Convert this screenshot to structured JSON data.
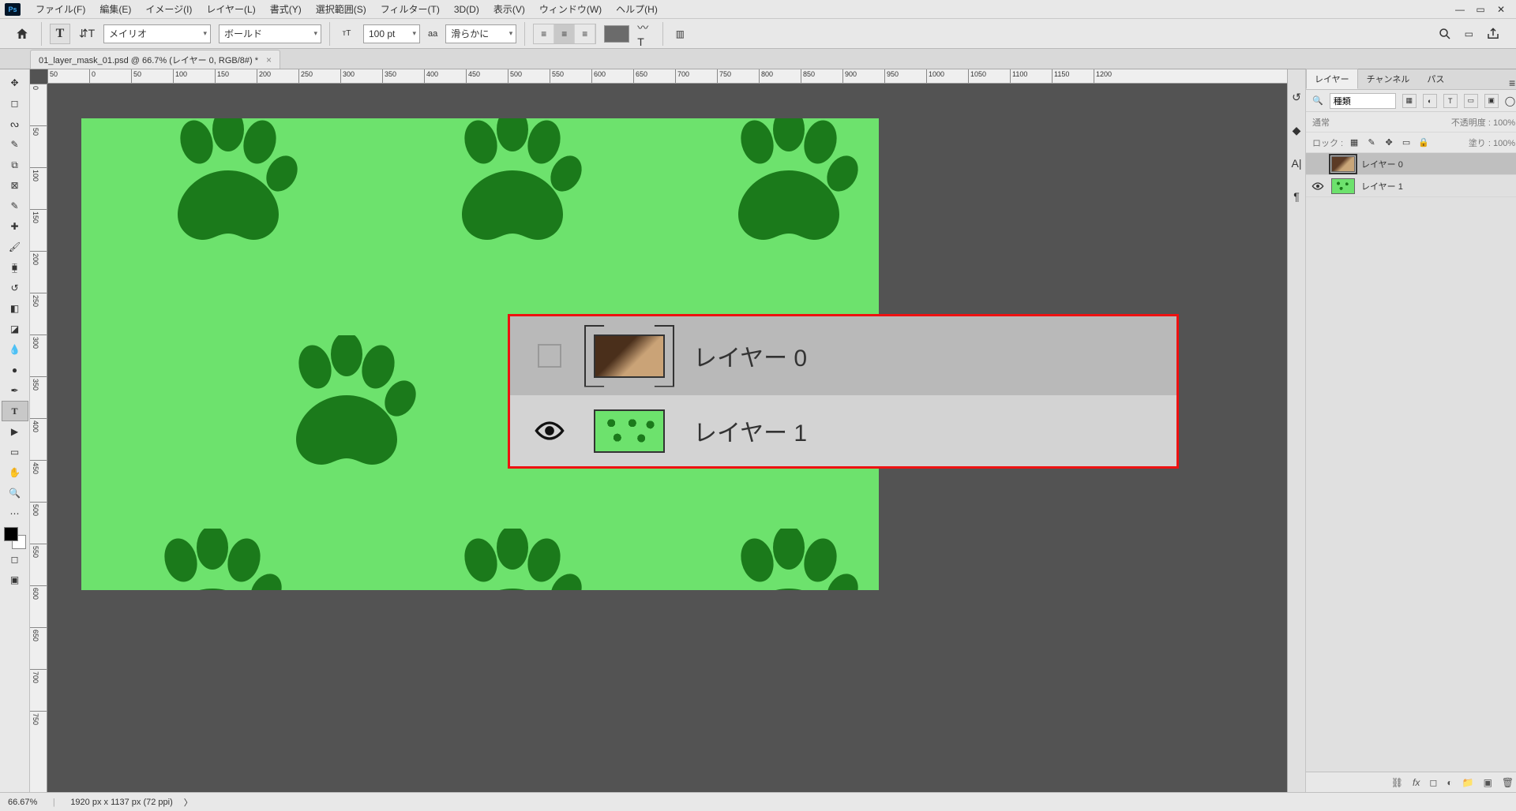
{
  "menu": {
    "items": [
      "ファイル(F)",
      "編集(E)",
      "イメージ(I)",
      "レイヤー(L)",
      "書式(Y)",
      "選択範囲(S)",
      "フィルター(T)",
      "3D(D)",
      "表示(V)",
      "ウィンドウ(W)",
      "ヘルプ(H)"
    ]
  },
  "options": {
    "font_family": "メイリオ",
    "font_weight": "ボールド",
    "font_size": "100 pt",
    "aa_label": "aa",
    "aa_value": "滑らかに"
  },
  "doc": {
    "tab_title": "01_layer_mask_01.psd @ 66.7% (レイヤー 0, RGB/8#) *"
  },
  "ruler_h": [
    50,
    0,
    50,
    100,
    150,
    200,
    250,
    300,
    350,
    400,
    450,
    500,
    550,
    600,
    650,
    700,
    750,
    800,
    850,
    900,
    950,
    1000,
    1050,
    1100,
    1150,
    1200
  ],
  "ruler_v": [
    "0",
    "50",
    "100",
    "150",
    "200",
    "250",
    "300",
    "350",
    "400",
    "450",
    "500",
    "550",
    "600",
    "650",
    "700",
    "750"
  ],
  "panel": {
    "tabs": [
      "レイヤー",
      "チャンネル",
      "パス"
    ],
    "filter_label": "種類",
    "blend_mode": "通常",
    "opacity_label": "不透明度 :",
    "opacity_value": "100%",
    "lock_label": "ロック :",
    "fill_label": "塗り :",
    "fill_value": "100%",
    "layers": [
      {
        "name": "レイヤー 0",
        "visible": false,
        "selected": true
      },
      {
        "name": "レイヤー 1",
        "visible": true,
        "selected": false
      }
    ]
  },
  "enlarge": {
    "rows": [
      {
        "name": "レイヤー 0",
        "visible": false,
        "selected": true
      },
      {
        "name": "レイヤー 1",
        "visible": true,
        "selected": false
      }
    ]
  },
  "statusbar": {
    "zoom": "66.67%",
    "dims": "1920 px x 1137 px (72 ppi)"
  }
}
